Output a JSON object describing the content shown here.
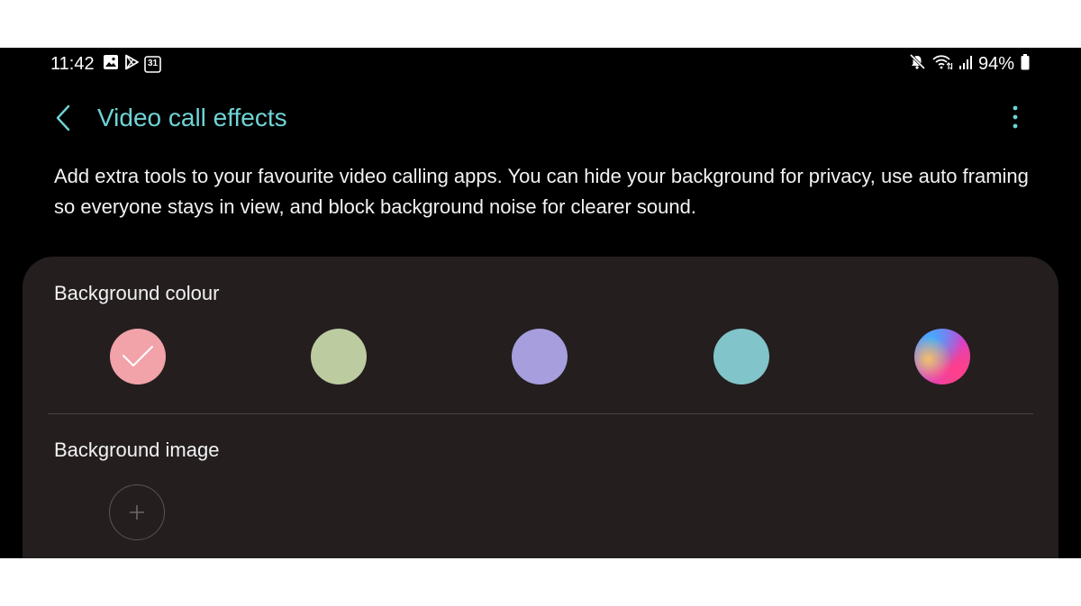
{
  "status_bar": {
    "time": "11:42",
    "left_icons": [
      "gallery-icon",
      "play-store-icon",
      "calendar-icon"
    ],
    "calendar_day": "31",
    "right_icons": [
      "mute-icon",
      "wifi-icon",
      "signal-icon"
    ],
    "battery_percent": "94%",
    "battery_level": 0.94
  },
  "header": {
    "back_icon": "chevron-left-icon",
    "title": "Video call effects",
    "menu_icon": "more-vertical-icon",
    "accent_color": "#6fd3d6"
  },
  "description": "Add extra tools to your favourite video calling apps. You can hide your background for privacy, use auto framing so everyone stays in view, and block background noise for clearer sound.",
  "background_colour": {
    "label": "Background colour",
    "swatches": [
      {
        "color": "#f2a2a9",
        "selected": true
      },
      {
        "color": "#bccca0",
        "selected": false
      },
      {
        "color": "#a79ede",
        "selected": false
      },
      {
        "color": "#81c4c9",
        "selected": false
      },
      {
        "color": "gradient",
        "selected": false
      }
    ]
  },
  "background_image": {
    "label": "Background image",
    "add_icon": "plus-icon"
  }
}
